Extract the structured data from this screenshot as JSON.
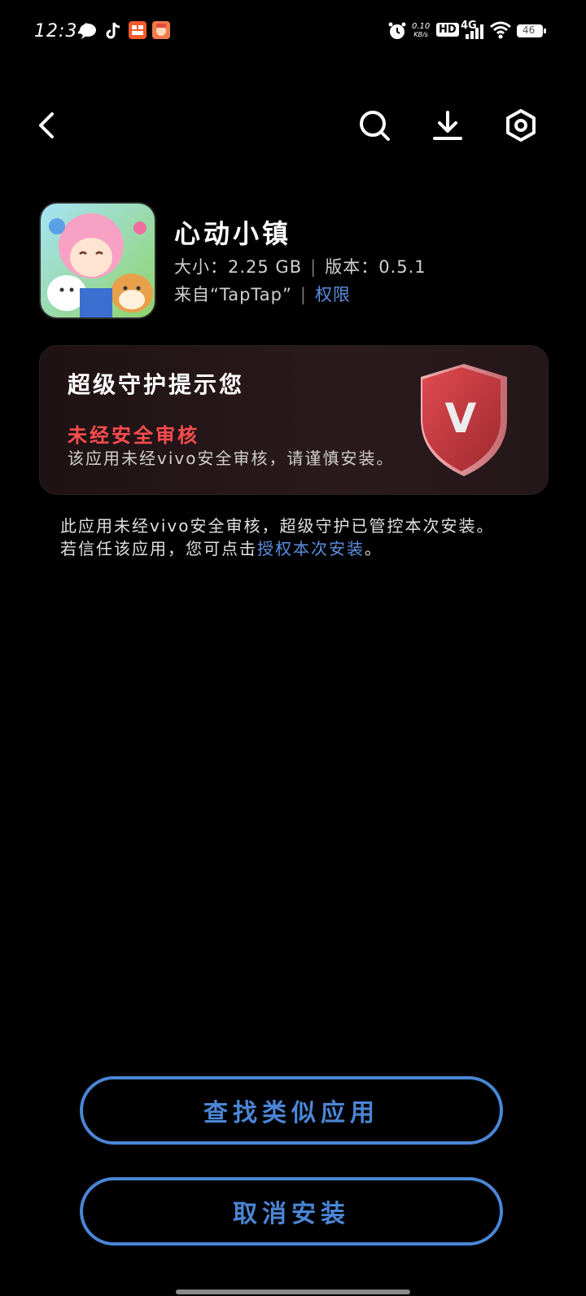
{
  "status_bar": {
    "time": "12:34",
    "net_speed_top": "0.10",
    "net_speed_bottom": "KB/s",
    "hd_label": "HD",
    "network": "4G",
    "battery": "46",
    "icons": [
      "message-icon",
      "tiktok-icon",
      "app-icon-orange",
      "app-icon-avatar",
      "alarm-icon",
      "wifi-icon",
      "battery-icon"
    ]
  },
  "nav": {
    "icons": [
      "back-icon",
      "search-icon",
      "download-icon",
      "settings-icon"
    ]
  },
  "app": {
    "name": "心动小镇",
    "size_label": "大小：",
    "size": "2.25 GB",
    "version_label": "版本：",
    "version": "0.5.1",
    "source": "来自“TapTap”",
    "permissions": "权限"
  },
  "card": {
    "title": "超级守护提示您",
    "warning": "未经安全审核",
    "description": "该应用未经vivo安全审核，请谨慎安装。",
    "shield_letter": "V"
  },
  "notice": {
    "line1": "此应用未经vivo安全审核，超级守护已管控本次安装。",
    "line2_prefix": "若信任该应用，您可点击",
    "line2_link": "授权本次安装",
    "line2_suffix": "。"
  },
  "buttons": {
    "find_similar": "查找类似应用",
    "cancel_install": "取消安装"
  },
  "colors": {
    "accent": "#4a86d6",
    "warning": "#ff4d4f",
    "link": "#5b8fdf"
  }
}
